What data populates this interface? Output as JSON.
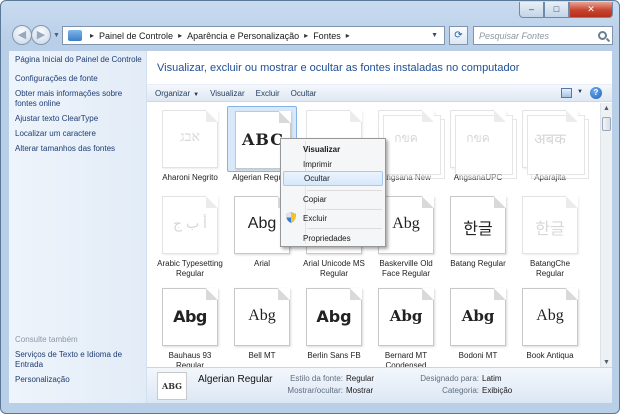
{
  "window": {
    "minimize_glyph": "–",
    "maximize_glyph": "□",
    "close_glyph": "✕"
  },
  "address_bar": {
    "crumbs": [
      "Painel de Controle",
      "Aparência e Personalização",
      "Fontes"
    ],
    "separator": "▸",
    "search_placeholder": "Pesquisar Fontes"
  },
  "sidebar": {
    "links": [
      "Página Inicial do Painel de Controle",
      "Configurações de fonte",
      "Obter mais informações sobre fontes online",
      "Ajustar texto ClearType",
      "Localizar um caractere",
      "Alterar tamanhos das fontes"
    ],
    "see_also_title": "Consulte também",
    "see_also_links": [
      "Serviços de Texto e Idioma de Entrada",
      "Personalização"
    ]
  },
  "main": {
    "heading": "Visualizar, excluir ou mostrar e ocultar as fontes instaladas no computador"
  },
  "toolbar": {
    "organize": "Organizar",
    "preview": "Visualizar",
    "delete": "Excluir",
    "hide": "Ocultar",
    "help": "?"
  },
  "fonts": [
    {
      "name": "Aharoni Negrito",
      "sample": "אבג",
      "style": "heb",
      "faded": true,
      "stack": false
    },
    {
      "name": "Algerian Regular",
      "sample": "ABC",
      "style": "alg",
      "faded": false,
      "stack": false,
      "selected": true
    },
    {
      "name": "",
      "sample": "",
      "style": "serif",
      "faded": true,
      "stack": false
    },
    {
      "name": "Angsana New",
      "sample": "กขค",
      "style": "thai",
      "faded": true,
      "stack": true
    },
    {
      "name": "AngsanaUPC",
      "sample": "กขค",
      "style": "thai",
      "faded": true,
      "stack": true
    },
    {
      "name": "Aparajita",
      "sample": "अबक",
      "style": "deva",
      "faded": true,
      "stack": true
    },
    {
      "name": "Arabic Typesetting Regular",
      "sample": "أ ب ج",
      "style": "arab",
      "faded": true,
      "stack": false
    },
    {
      "name": "Arial",
      "sample": "Abg",
      "style": "sans",
      "faded": false,
      "stack": true
    },
    {
      "name": "Arial Unicode MS Regular",
      "sample": "Abg",
      "style": "sans",
      "faded": false,
      "stack": false
    },
    {
      "name": "Baskerville Old Face Regular",
      "sample": "Abg",
      "style": "serif",
      "faded": false,
      "stack": false
    },
    {
      "name": "Batang Regular",
      "sample": "한글",
      "style": "sans",
      "faded": false,
      "stack": false
    },
    {
      "name": "BatangChe Regular",
      "sample": "한글",
      "style": "sans",
      "faded": true,
      "stack": false
    },
    {
      "name": "Bauhaus 93 Regular",
      "sample": "Abg",
      "style": "black",
      "faded": false,
      "stack": false
    },
    {
      "name": "Bell MT",
      "sample": "Abg",
      "style": "serif",
      "faded": false,
      "stack": true
    },
    {
      "name": "Berlin Sans FB",
      "sample": "Abg",
      "style": "bold",
      "faded": false,
      "stack": true
    },
    {
      "name": "Bernard MT Condensed",
      "sample": "Abg",
      "style": "bodoni",
      "faded": false,
      "stack": false
    },
    {
      "name": "Bodoni MT",
      "sample": "Abg",
      "style": "bodoni",
      "faded": false,
      "stack": true
    },
    {
      "name": "Book Antiqua",
      "sample": "Abg",
      "style": "serif",
      "faded": false,
      "stack": true
    }
  ],
  "context_menu": {
    "items": [
      "Visualizar",
      "Imprimir",
      "Ocultar",
      "Copiar",
      "Excluir",
      "Propriedades"
    ]
  },
  "details": {
    "thumb_sample": "ABG",
    "name": "Algerian Regular",
    "style_label": "Estilo da fonte:",
    "style_value": "Regular",
    "visibility_label": "Mostrar/ocultar:",
    "visibility_value": "Mostrar",
    "designed_label": "Designado para:",
    "designed_value": "Latim",
    "category_label": "Categoria:",
    "category_value": "Exibição"
  },
  "colors": {
    "window_frame": "#b9cfe8",
    "link": "#1e3d74",
    "heading": "#1f4f93",
    "selection": "#d9e9fa"
  }
}
